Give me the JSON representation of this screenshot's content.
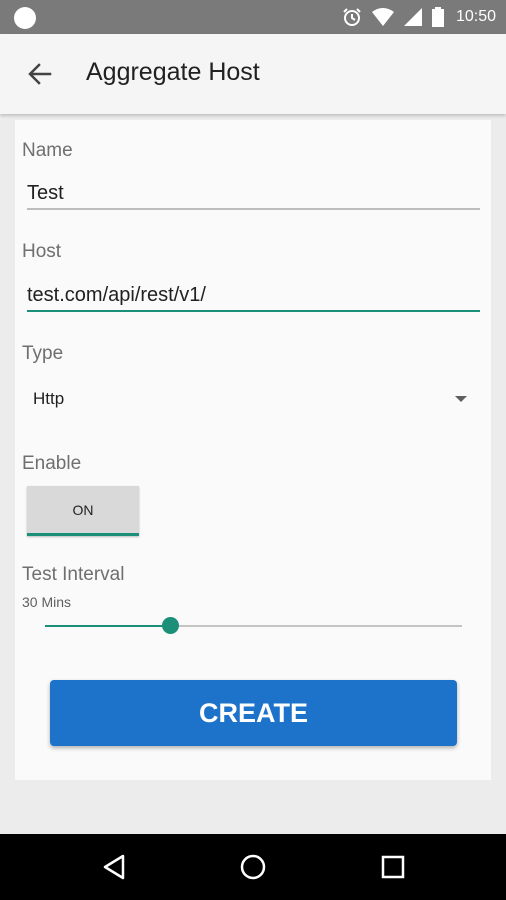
{
  "status_bar": {
    "time": "10:50",
    "icons": [
      "alarm-icon",
      "wifi-icon",
      "signal-icon",
      "battery-icon"
    ]
  },
  "app_bar": {
    "back_icon": "arrow-back-icon",
    "title": "Aggregate Host"
  },
  "form": {
    "name": {
      "label": "Name",
      "value": "Test"
    },
    "host": {
      "label": "Host",
      "value": "test.com/api/rest/v1/"
    },
    "type": {
      "label": "Type",
      "selected": "Http"
    },
    "enable": {
      "label": "Enable",
      "toggle_text": "ON"
    },
    "test_interval": {
      "label": "Test Interval",
      "value_text": "30 Mins",
      "slider_fraction": 0.3
    },
    "create_label": "CREATE"
  },
  "nav_bar": {
    "icons": [
      "nav-back-icon",
      "nav-home-icon",
      "nav-recents-icon"
    ]
  },
  "colors": {
    "accent": "#1b8f78",
    "primary_button": "#1d72c9",
    "status_bar": "#7a7a7a"
  }
}
